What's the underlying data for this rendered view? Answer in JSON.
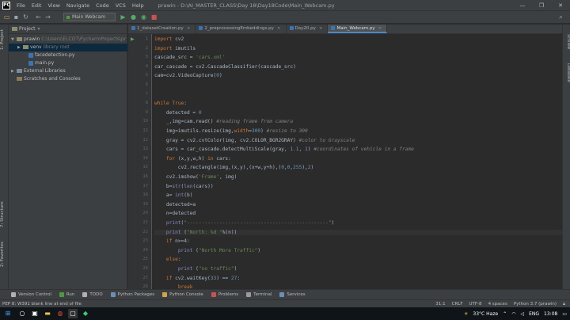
{
  "menubar": {
    "logo": "PC",
    "items": [
      "File",
      "Edit",
      "View",
      "Navigate",
      "Code",
      "VCS",
      "Help"
    ],
    "window_title": "prawin - D:\\AI_MASTER_CLASS\\Day 18\\Day18Code\\Main_Webcam.py",
    "controls": [
      "—",
      "❐",
      "✕"
    ]
  },
  "toolbar": {
    "run_config": "Main Webcam"
  },
  "left_strip": {
    "project_tab": "1: Project",
    "structure_tab": "7: Structure",
    "favorites_tab": "2: Favorites"
  },
  "right_strip": {
    "scientific_tab": "SciView",
    "db_tab": "Database"
  },
  "project": {
    "header": "Project",
    "tree": [
      {
        "label": "prawin",
        "path": "C:\\Users\\ELCOT\\PycharmProjects\\pr",
        "indent": 0,
        "type": "folder",
        "open": true
      },
      {
        "label": "venv",
        "extra": "library root",
        "indent": 1,
        "type": "folder",
        "open": false,
        "selected": true
      },
      {
        "label": "facedetection.py",
        "indent": 1,
        "type": "py"
      },
      {
        "label": "main.py",
        "indent": 1,
        "type": "py"
      },
      {
        "label": "External Libraries",
        "indent": 0,
        "type": "lib",
        "open": false
      },
      {
        "label": "Scratches and Consoles",
        "indent": 0,
        "type": "scratch"
      }
    ]
  },
  "editor": {
    "tabs": [
      {
        "label": "1_datasetCreation.py",
        "active": false
      },
      {
        "label": "2_preprocessingEmbeddings.py",
        "active": false
      },
      {
        "label": "Day20.py",
        "active": false
      },
      {
        "label": "Main_Webcam.py",
        "active": true
      }
    ],
    "line_numbers": [
      "1",
      "2",
      "3",
      "4",
      "5",
      "6",
      "7",
      "8",
      "9",
      "10",
      "11",
      "12",
      "13",
      "14",
      "15",
      "16",
      "17",
      "18",
      "19",
      "20",
      "21",
      "22",
      "23",
      "24",
      "25",
      "26",
      "27",
      "28",
      "29",
      "30"
    ],
    "lines": [
      [
        {
          "t": "import",
          "c": "kw"
        },
        {
          "t": " cv2",
          "c": ""
        }
      ],
      [
        {
          "t": "import",
          "c": "kw"
        },
        {
          "t": " imutils",
          "c": ""
        }
      ],
      [
        {
          "t": "cascade_src = ",
          "c": ""
        },
        {
          "t": "'cars.xml'",
          "c": "str"
        }
      ],
      [
        {
          "t": "car_cascade = cv2.CascadeClassifier(cascade_src)",
          "c": ""
        }
      ],
      [
        {
          "t": "cam=cv2.VideoCapture(",
          "c": ""
        },
        {
          "t": "0",
          "c": "num"
        },
        {
          "t": ")",
          "c": ""
        }
      ],
      [],
      [],
      [
        {
          "t": "while",
          "c": "kw"
        },
        {
          "t": " ",
          "c": ""
        },
        {
          "t": "True",
          "c": "kw"
        },
        {
          "t": ":",
          "c": ""
        }
      ],
      [
        {
          "t": "    detected = ",
          "c": ""
        },
        {
          "t": "0",
          "c": "num"
        }
      ],
      [
        {
          "t": "    _,img=cam.read() ",
          "c": ""
        },
        {
          "t": "#reading frame from camera",
          "c": "com"
        }
      ],
      [
        {
          "t": "    img=imutils.resize(img,",
          "c": ""
        },
        {
          "t": "width",
          "c": "kw"
        },
        {
          "t": "=",
          "c": ""
        },
        {
          "t": "300",
          "c": "num"
        },
        {
          "t": ") ",
          "c": ""
        },
        {
          "t": "#resize to 300",
          "c": "com"
        }
      ],
      [
        {
          "t": "    gray = cv2.cvtColor(img, cv2.COLOR_BGR2GRAY) ",
          "c": ""
        },
        {
          "t": "#color to Grayscale",
          "c": "com"
        }
      ],
      [
        {
          "t": "    cars = car_cascade.detectMultiScale(gray, ",
          "c": ""
        },
        {
          "t": "1.1",
          "c": "num"
        },
        {
          "t": ", ",
          "c": ""
        },
        {
          "t": "1",
          "c": "num"
        },
        {
          "t": ") ",
          "c": ""
        },
        {
          "t": "#coordinates of vehicle in a frame",
          "c": "com"
        }
      ],
      [
        {
          "t": "    ",
          "c": ""
        },
        {
          "t": "for",
          "c": "kw"
        },
        {
          "t": " (x,y,w,h) ",
          "c": ""
        },
        {
          "t": "in",
          "c": "kw"
        },
        {
          "t": " cars:",
          "c": ""
        }
      ],
      [
        {
          "t": "        cv2.rectangle(img,(x,y),(x+w,y+h),(",
          "c": ""
        },
        {
          "t": "0",
          "c": "num"
        },
        {
          "t": ",",
          "c": ""
        },
        {
          "t": "0",
          "c": "num"
        },
        {
          "t": ",",
          "c": ""
        },
        {
          "t": "255",
          "c": "num"
        },
        {
          "t": "),",
          "c": ""
        },
        {
          "t": "2",
          "c": "num"
        },
        {
          "t": ")",
          "c": ""
        }
      ],
      [
        {
          "t": "    cv2.imshow(",
          "c": ""
        },
        {
          "t": "'Frame'",
          "c": "str"
        },
        {
          "t": ", img)",
          "c": ""
        }
      ],
      [
        {
          "t": "    b=",
          "c": ""
        },
        {
          "t": "str",
          "c": "bi"
        },
        {
          "t": "(",
          "c": ""
        },
        {
          "t": "len",
          "c": "bi"
        },
        {
          "t": "(cars))",
          "c": ""
        }
      ],
      [
        {
          "t": "    a= ",
          "c": ""
        },
        {
          "t": "int",
          "c": "bi"
        },
        {
          "t": "(b)",
          "c": ""
        }
      ],
      [
        {
          "t": "    detected=a",
          "c": ""
        }
      ],
      [
        {
          "t": "    n=detected",
          "c": ""
        }
      ],
      [
        {
          "t": "    ",
          "c": ""
        },
        {
          "t": "print",
          "c": "bi"
        },
        {
          "t": "(",
          "c": ""
        },
        {
          "t": "\"------------------------------------------------\"",
          "c": "str"
        },
        {
          "t": ")",
          "c": ""
        }
      ],
      [
        {
          "t": "    ",
          "c": ""
        },
        {
          "t": "print",
          "c": "bi"
        },
        {
          "t": " (",
          "c": ""
        },
        {
          "t": "\"North: %d \"",
          "c": "str"
        },
        {
          "t": "%(n))",
          "c": ""
        }
      ],
      [
        {
          "t": "    ",
          "c": ""
        },
        {
          "t": "if",
          "c": "kw"
        },
        {
          "t": " n>=4:",
          "c": ""
        }
      ],
      [
        {
          "t": "        ",
          "c": ""
        },
        {
          "t": "print",
          "c": "bi"
        },
        {
          "t": " (",
          "c": ""
        },
        {
          "t": "\"North More Traffic\"",
          "c": "str"
        },
        {
          "t": ")",
          "c": ""
        }
      ],
      [
        {
          "t": "    ",
          "c": ""
        },
        {
          "t": "else",
          "c": "kw"
        },
        {
          "t": ":",
          "c": ""
        }
      ],
      [
        {
          "t": "        ",
          "c": ""
        },
        {
          "t": "print",
          "c": "bi"
        },
        {
          "t": " (",
          "c": ""
        },
        {
          "t": "\"no traffic\"",
          "c": "str"
        },
        {
          "t": ")",
          "c": ""
        }
      ],
      [
        {
          "t": "    ",
          "c": ""
        },
        {
          "t": "if",
          "c": "kw"
        },
        {
          "t": " cv2.waitKey(",
          "c": ""
        },
        {
          "t": "33",
          "c": "num"
        },
        {
          "t": ") == ",
          "c": ""
        },
        {
          "t": "27",
          "c": "num"
        },
        {
          "t": ":",
          "c": ""
        }
      ],
      [
        {
          "t": "        ",
          "c": ""
        },
        {
          "t": "break",
          "c": "kw"
        }
      ]
    ]
  },
  "bottom_tabs": [
    {
      "label": "Version Control",
      "color": "#b0b0b0"
    },
    {
      "label": "Run",
      "color": "#4e9a3c"
    },
    {
      "label": "TODO",
      "color": "#b0b0b0"
    },
    {
      "label": "Python Packages",
      "color": "#6d8fb5"
    },
    {
      "label": "Python Console",
      "color": "#cfa54a"
    },
    {
      "label": "Problems",
      "color": "#c75450"
    },
    {
      "label": "Terminal",
      "color": "#9a9a9a"
    },
    {
      "label": "Services",
      "color": "#6d8fb5"
    }
  ],
  "statusbar": {
    "message": "PEP 8: W391 blank line at end of file",
    "position": "31:1",
    "line_sep": "CRLF",
    "encoding": "UTF-8",
    "indent": "4 spaces",
    "interpreter": "Python 3.7 (prawin)"
  },
  "taskbar": {
    "weather": "33°C Haze",
    "lang": "ENG",
    "time": "13:08"
  }
}
